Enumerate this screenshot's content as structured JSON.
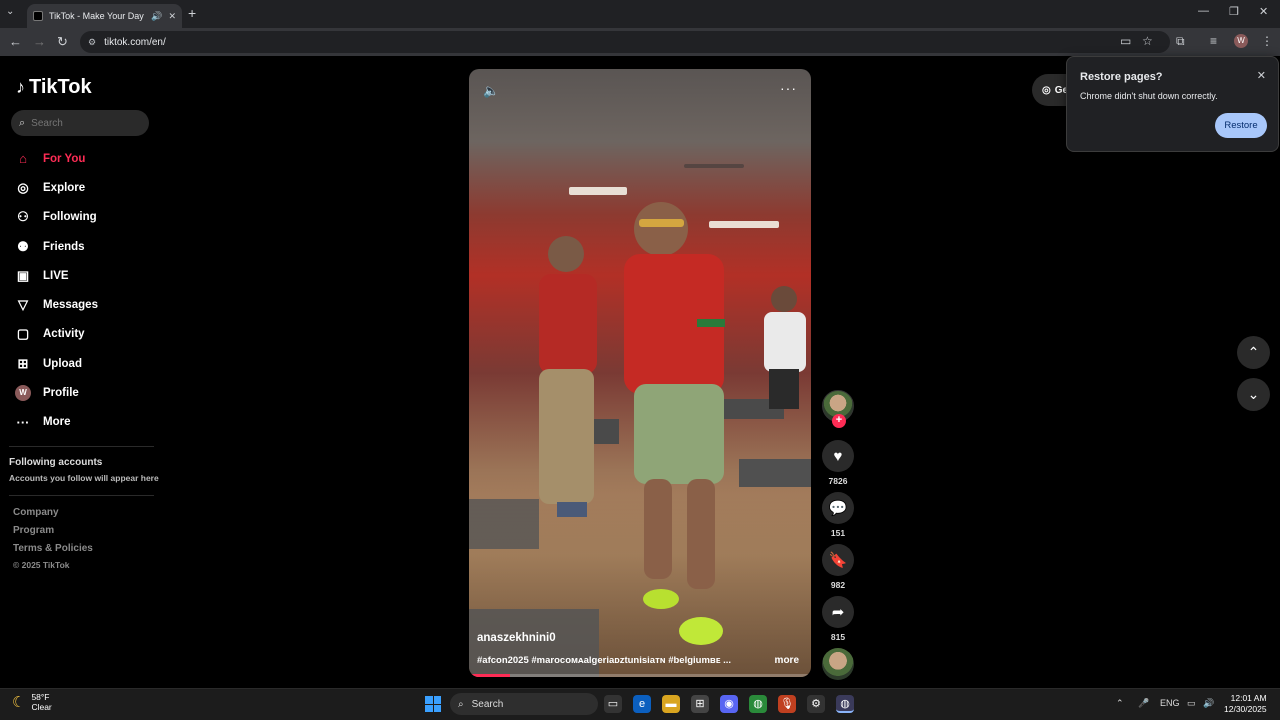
{
  "browser": {
    "tab_title": "TikTok - Make Your Day",
    "url": "tiktok.com/en/",
    "profile_initial": "W"
  },
  "sidebar": {
    "logo": "TikTok",
    "search_placeholder": "Search",
    "nav": [
      {
        "label": "For You",
        "icon": "home-icon",
        "active": true
      },
      {
        "label": "Explore",
        "icon": "compass-icon"
      },
      {
        "label": "Following",
        "icon": "person-plus-icon"
      },
      {
        "label": "Friends",
        "icon": "friends-icon"
      },
      {
        "label": "LIVE",
        "icon": "live-icon"
      },
      {
        "label": "Messages",
        "icon": "send-icon"
      },
      {
        "label": "Activity",
        "icon": "message-square-icon"
      },
      {
        "label": "Upload",
        "icon": "plus-square-icon"
      },
      {
        "label": "Profile",
        "icon": "avatar"
      },
      {
        "label": "More",
        "icon": "more-dots-icon"
      }
    ],
    "profile_initial": "W",
    "following_accounts_title": "Following accounts",
    "following_accounts_sub": "Accounts you follow will appear here",
    "footer": [
      "Company",
      "Program",
      "Terms & Policies"
    ],
    "copyright": "© 2025 TikTok"
  },
  "video": {
    "author": "anaszekhnini0",
    "caption": "#afcon2025 #marocoᴍᴀalgeriaᴅᴢtunisiaᴛɴ #belgiumʙᴇ ...",
    "more_label": "more",
    "progress": 0.12
  },
  "actions": {
    "likes": "7826",
    "comments": "151",
    "saves": "982",
    "shares": "815"
  },
  "get_app_label": "Ge",
  "restore": {
    "title": "Restore pages?",
    "desc": "Chrome didn't shut down correctly.",
    "button": "Restore"
  },
  "taskbar": {
    "temp": "58°F",
    "condition": "Clear",
    "search": "Search",
    "lang": "ENG",
    "time": "12:01 AM",
    "date": "12/30/2025"
  },
  "colors": {
    "accent": "#fe2c55",
    "restore_button": "#a8c7fa"
  }
}
